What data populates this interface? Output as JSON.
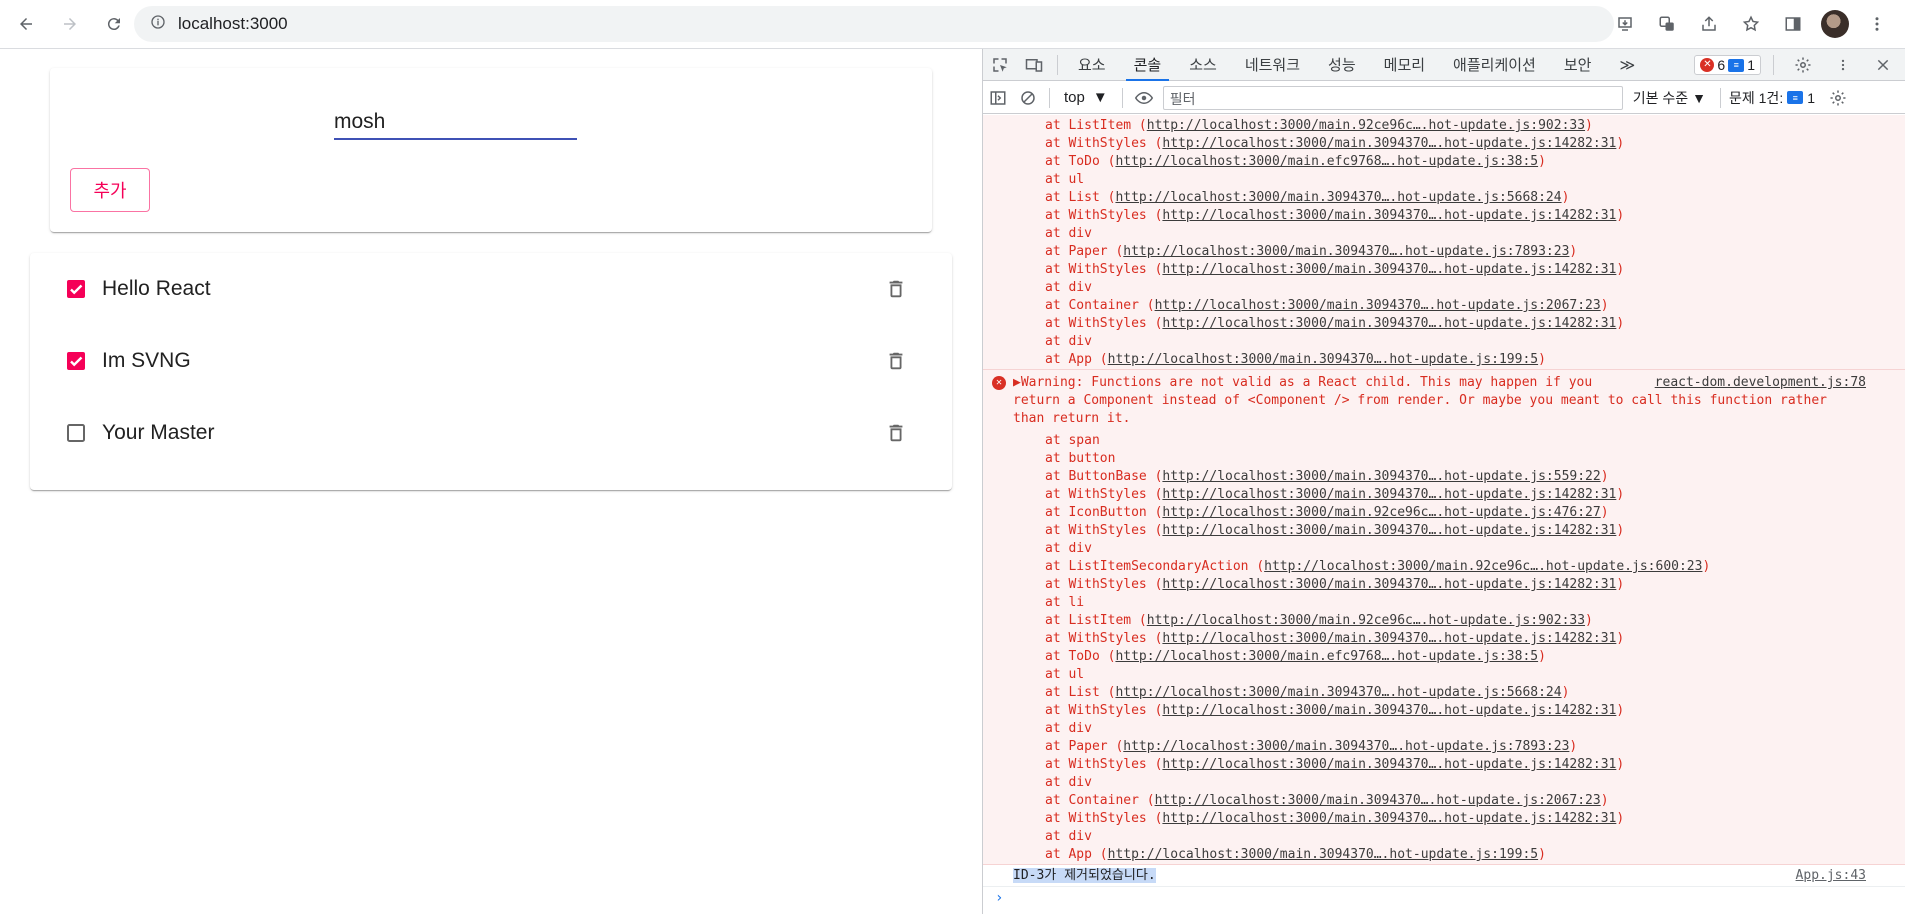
{
  "browser": {
    "url": "localhost:3000"
  },
  "app": {
    "input_value": "mosh",
    "add_button": "추가",
    "todos": [
      {
        "label": "Hello React",
        "checked": true
      },
      {
        "label": "Im SVNG",
        "checked": true
      },
      {
        "label": "Your Master",
        "checked": false
      }
    ],
    "colors": {
      "accent": "#f50057",
      "primary": "#3f51b5"
    }
  },
  "devtools": {
    "tabs": [
      "요소",
      "콘솔",
      "소스",
      "네트워크",
      "성능",
      "메모리",
      "애플리케이션",
      "보안"
    ],
    "active_tab": "콘솔",
    "more": "≫",
    "error_count": "6",
    "message_count": "1",
    "context": "top",
    "filter_placeholder": "필터",
    "levels": "기본 수준",
    "issues_label": "문제 1건:",
    "issues_count": "1",
    "stack_top": [
      {
        "t": "at ListItem (",
        "l": "http://localhost:3000/main.92ce96c….hot-update.js:902:33",
        "e": ")"
      },
      {
        "t": "at WithStyles (",
        "l": "http://localhost:3000/main.3094370….hot-update.js:14282:31",
        "e": ")"
      },
      {
        "t": "at ToDo (",
        "l": "http://localhost:3000/main.efc9768….hot-update.js:38:5",
        "e": ")"
      },
      {
        "t": "at ul",
        "l": "",
        "e": ""
      },
      {
        "t": "at List (",
        "l": "http://localhost:3000/main.3094370….hot-update.js:5668:24",
        "e": ")"
      },
      {
        "t": "at WithStyles (",
        "l": "http://localhost:3000/main.3094370….hot-update.js:14282:31",
        "e": ")"
      },
      {
        "t": "at div",
        "l": "",
        "e": ""
      },
      {
        "t": "at Paper (",
        "l": "http://localhost:3000/main.3094370….hot-update.js:7893:23",
        "e": ")"
      },
      {
        "t": "at WithStyles (",
        "l": "http://localhost:3000/main.3094370….hot-update.js:14282:31",
        "e": ")"
      },
      {
        "t": "at div",
        "l": "",
        "e": ""
      },
      {
        "t": "at Container (",
        "l": "http://localhost:3000/main.3094370….hot-update.js:2067:23",
        "e": ")"
      },
      {
        "t": "at WithStyles (",
        "l": "http://localhost:3000/main.3094370….hot-update.js:14282:31",
        "e": ")"
      },
      {
        "t": "at div",
        "l": "",
        "e": ""
      },
      {
        "t": "at App (",
        "l": "http://localhost:3000/main.3094370….hot-update.js:199:5",
        "e": ")"
      }
    ],
    "warning": {
      "line1": "▶Warning: Functions are not valid as a React child. This may happen if you",
      "line2": "return a Component instead of <Component /> from render. Or maybe you meant to call this function rather",
      "line3": "than return it.",
      "source": "react-dom.development.js:78"
    },
    "stack_bottom": [
      {
        "t": "at span",
        "l": "",
        "e": ""
      },
      {
        "t": "at button",
        "l": "",
        "e": ""
      },
      {
        "t": "at ButtonBase (",
        "l": "http://localhost:3000/main.3094370….hot-update.js:559:22",
        "e": ")"
      },
      {
        "t": "at WithStyles (",
        "l": "http://localhost:3000/main.3094370….hot-update.js:14282:31",
        "e": ")"
      },
      {
        "t": "at IconButton (",
        "l": "http://localhost:3000/main.92ce96c….hot-update.js:476:27",
        "e": ")"
      },
      {
        "t": "at WithStyles (",
        "l": "http://localhost:3000/main.3094370….hot-update.js:14282:31",
        "e": ")"
      },
      {
        "t": "at div",
        "l": "",
        "e": ""
      },
      {
        "t": "at ListItemSecondaryAction (",
        "l": "http://localhost:3000/main.92ce96c….hot-update.js:600:23",
        "e": ")"
      },
      {
        "t": "at WithStyles (",
        "l": "http://localhost:3000/main.3094370….hot-update.js:14282:31",
        "e": ")"
      },
      {
        "t": "at li",
        "l": "",
        "e": ""
      },
      {
        "t": "at ListItem (",
        "l": "http://localhost:3000/main.92ce96c….hot-update.js:902:33",
        "e": ")"
      },
      {
        "t": "at WithStyles (",
        "l": "http://localhost:3000/main.3094370….hot-update.js:14282:31",
        "e": ")"
      },
      {
        "t": "at ToDo (",
        "l": "http://localhost:3000/main.efc9768….hot-update.js:38:5",
        "e": ")"
      },
      {
        "t": "at ul",
        "l": "",
        "e": ""
      },
      {
        "t": "at List (",
        "l": "http://localhost:3000/main.3094370….hot-update.js:5668:24",
        "e": ")"
      },
      {
        "t": "at WithStyles (",
        "l": "http://localhost:3000/main.3094370….hot-update.js:14282:31",
        "e": ")"
      },
      {
        "t": "at div",
        "l": "",
        "e": ""
      },
      {
        "t": "at Paper (",
        "l": "http://localhost:3000/main.3094370….hot-update.js:7893:23",
        "e": ")"
      },
      {
        "t": "at WithStyles (",
        "l": "http://localhost:3000/main.3094370….hot-update.js:14282:31",
        "e": ")"
      },
      {
        "t": "at div",
        "l": "",
        "e": ""
      },
      {
        "t": "at Container (",
        "l": "http://localhost:3000/main.3094370….hot-update.js:2067:23",
        "e": ")"
      },
      {
        "t": "at WithStyles (",
        "l": "http://localhost:3000/main.3094370….hot-update.js:14282:31",
        "e": ")"
      },
      {
        "t": "at div",
        "l": "",
        "e": ""
      },
      {
        "t": "at App (",
        "l": "http://localhost:3000/main.3094370….hot-update.js:199:5",
        "e": ")"
      }
    ],
    "log": {
      "text": "ID-3가 제거되었습니다.",
      "source": "App.js:43"
    },
    "prompt": "›"
  }
}
